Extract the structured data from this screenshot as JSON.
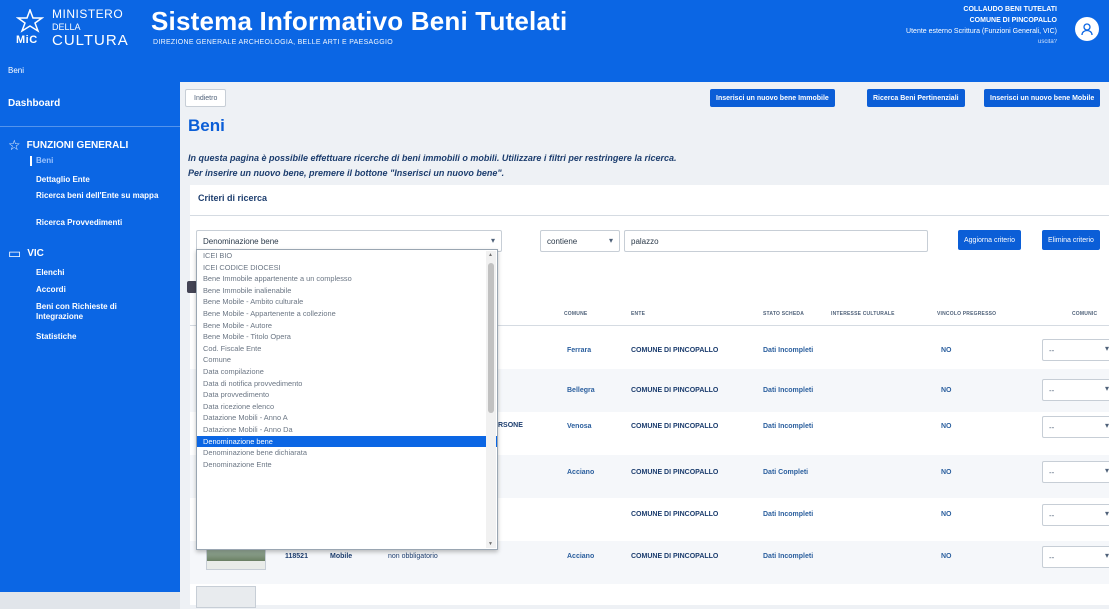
{
  "header": {
    "logo_line1": "MINISTERO",
    "logo_line2": "DELLA",
    "logo_line3": "CULTURA",
    "logo_mic": "MiC",
    "app_title": "Sistema Informativo Beni Tutelati",
    "app_subtitle": "DIREZIONE GENERALE ARCHEOLOGIA, BELLE ARTI E PAESAGGIO",
    "user_line1": "COLLAUDO BENI TUTELATI",
    "user_line2": "COMUNE DI PINCOPALLO",
    "user_line3": "Utente esterno Scrittura (Funzioni Generali, VIC)",
    "user_line4": "uscita?",
    "breadcrumb": "Beni"
  },
  "sidebar": {
    "dashboard": "Dashboard",
    "section1": "FUNZIONI GENERALI",
    "section1_items": [
      "Beni",
      "Dettaglio Ente",
      "Ricerca beni dell'Ente su mappa",
      "Ricerca Provvedimenti"
    ],
    "section2": "VIC",
    "section2_items": [
      "Elenchi",
      "Accordi",
      "Beni con Richieste di Integrazione",
      "Statistiche"
    ]
  },
  "toolbar": {
    "back": "Indietro",
    "new_immobile": "Inserisci un nuovo bene Immobile",
    "search_pertinenziali": "Ricerca Beni Pertinenziali",
    "new_mobile": "Inserisci un nuovo bene Mobile"
  },
  "page": {
    "title": "Beni",
    "desc1": "In questa pagina è possibile effettuare ricerche di beni immobili o mobili. Utilizzare i filtri per restringere la ricerca.",
    "desc2": "Per inserire un nuovo bene, premere il bottone \"Inserisci un nuovo bene\"."
  },
  "criteria": {
    "title": "Criteri di ricerca",
    "field_selected": "Denominazione bene",
    "operator": "contiene",
    "value": "palazzo",
    "update_btn": "Aggiorna criterio",
    "delete_btn": "Elimina criterio"
  },
  "dropdown_options": [
    "ICEI BIO",
    "ICEI CODICE DIOCESI",
    "Bene Immobile appartenente a un complesso",
    "Bene Immobile inalienabile",
    "Bene Mobile - Ambito culturale",
    "Bene Mobile - Appartenente a collezione",
    "Bene Mobile - Autore",
    "Bene Mobile - Titolo Opera",
    "Cod. Fiscale Ente",
    "Comune",
    "Data compilazione",
    "Data di notifica provvedimento",
    "Data provvedimento",
    "Data ricezione elenco",
    "Datazione Mobili - Anno A",
    "Datazione Mobili - Anno Da",
    "Denominazione bene",
    "Denominazione bene dichiarata",
    "Denominazione Ente"
  ],
  "dropdown_selected_index": 16,
  "table": {
    "headers": [
      "COMUNE",
      "ENTE",
      "STATO SCHEDA",
      "INTERESSE CULTURALE",
      "VINCOLO PREGRESSO",
      "COMUNIC"
    ],
    "rows": [
      {
        "comune": "Ferrara",
        "ente": "COMUNE DI PINCOPALLO",
        "stato": "Dati Incompleti",
        "vincolo": "NO",
        "select": "--"
      },
      {
        "comune": "Bellegra",
        "ente": "COMUNE DI PINCOPALLO",
        "stato": "Dati Incompleti",
        "vincolo": "NO",
        "select": "--"
      },
      {
        "comune": "Venosa",
        "ente": "COMUNE DI PINCOPALLO",
        "stato": "Dati Incompleti",
        "vincolo": "NO",
        "select": "--",
        "extra": "RSONE"
      },
      {
        "comune": "Acciano",
        "ente": "COMUNE DI PINCOPALLO",
        "stato": "Dati Completi",
        "vincolo": "NO",
        "select": "--"
      },
      {
        "comune": "",
        "ente": "COMUNE DI PINCOPALLO",
        "stato": "Dati Incompleti",
        "vincolo": "NO",
        "select": "--"
      },
      {
        "id": "118521",
        "tipo": "Mobile",
        "visibilita": "non obbligatorio",
        "comune": "Acciano",
        "ente": "COMUNE DI PINCOPALLO",
        "stato": "Dati Incompleti",
        "vincolo": "NO",
        "select": "--"
      }
    ]
  },
  "colors": {
    "brand": "#0b66e4",
    "accent": "#0b5ed7"
  }
}
